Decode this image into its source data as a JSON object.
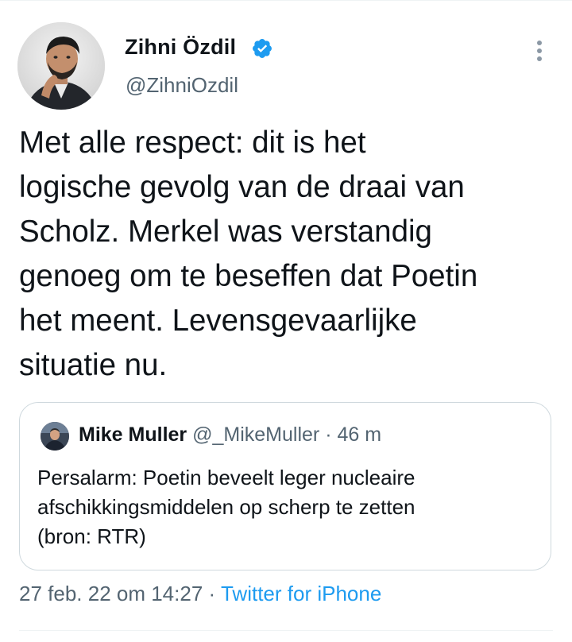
{
  "author": {
    "display_name": "Zihni Özdil",
    "handle": "@ZihniOzdil",
    "verified": true,
    "avatar_icon": "profile-photo"
  },
  "tweet": {
    "text": "Met alle respect: dit is het\nlogische gevolg van de draai van\nScholz. Merkel was verstandig\ngenoeg om te beseffen dat Poetin\nhet meent. Levensgevaarlijke\nsituatie nu."
  },
  "quoted_tweet": {
    "display_name": "Mike Muller",
    "handle": "@_MikeMuller",
    "separator": "·",
    "time": "46 m",
    "text": "Persalarm: Poetin beveelt leger nucleaire\nafschikkingsmiddelen op scherp te zetten\n(bron: RTR)"
  },
  "meta": {
    "timestamp": "27 feb. 22 om 14:27",
    "separator": "·",
    "source": "Twitter for iPhone"
  },
  "colors": {
    "text_primary": "#0f1419",
    "text_secondary": "#536471",
    "accent": "#1d9bf0",
    "border": "#cfd9de"
  }
}
